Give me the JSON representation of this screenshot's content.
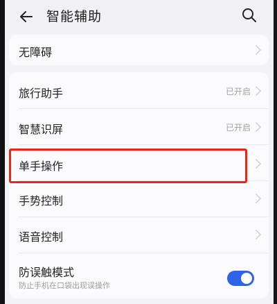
{
  "header": {
    "title": "智能辅助",
    "back_icon": "back-arrow-icon",
    "search_icon": "search-icon"
  },
  "accessibility_card": {
    "label": "无障碍",
    "chevron_icon": "chevron-right-icon"
  },
  "settings": {
    "items": [
      {
        "label": "旅行助手",
        "status": "已开启",
        "chevron_icon": "chevron-right-icon"
      },
      {
        "label": "智慧识屏",
        "status": "已开启",
        "chevron_icon": "chevron-right-icon"
      },
      {
        "label": "单手操作",
        "chevron_icon": "chevron-right-icon"
      },
      {
        "label": "手势控制",
        "chevron_icon": "chevron-right-icon"
      },
      {
        "label": "语音控制",
        "chevron_icon": "chevron-right-icon"
      },
      {
        "label": "防误触模式",
        "description": "防止手机在口袋出现误操作",
        "toggle_on": true
      }
    ]
  },
  "colors": {
    "accent": "#2f63e7",
    "highlight": "#ea2618",
    "background": "#f3f3f5",
    "card": "#fbfbfd",
    "primary_text": "#232323",
    "secondary_text": "#a2a2a2"
  }
}
